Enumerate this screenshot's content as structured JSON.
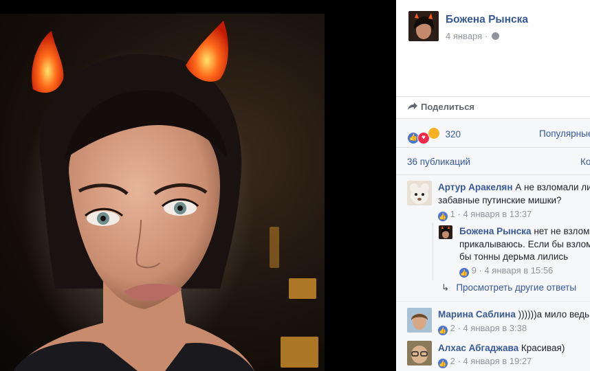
{
  "post": {
    "author": "Божена Рынска",
    "date": "4 января",
    "separator": "·",
    "privacy_icon": "globe-icon"
  },
  "actions": {
    "share_label": "Поделиться"
  },
  "reactions": {
    "count": "320",
    "sort_label": "Популярные"
  },
  "shares": {
    "label": "36 публикаций",
    "right_partial": "Ко"
  },
  "comments": [
    {
      "author": "Артур Аракелян",
      "text_line1": "А не взломали ли",
      "text_line2": "забавные путинские мишки?",
      "likes": "1",
      "time": "4 января в 13:37",
      "reply": {
        "author": "Божена Рынска",
        "text_line1": "нет не взлом",
        "text_line2": "прикалываюсь. Если бы взлом",
        "text_line3": "бы тонны дерьма лились",
        "likes": "9",
        "time": "4 января в 15:56"
      },
      "more_replies": "Просмотреть другие ответы"
    },
    {
      "author": "Марина Саблина",
      "text": "))))))а мило ведь!",
      "likes": "2",
      "time": "4 января в 3:38"
    },
    {
      "author": "Алхас Абгаджава",
      "text": "Красивая)",
      "likes": "2",
      "time": "4 января в 19:27"
    }
  ],
  "colors": {
    "link": "#365899",
    "like_blue": "#4a76d8",
    "love_red": "#f0284a",
    "haha_yellow": "#f7b125"
  }
}
